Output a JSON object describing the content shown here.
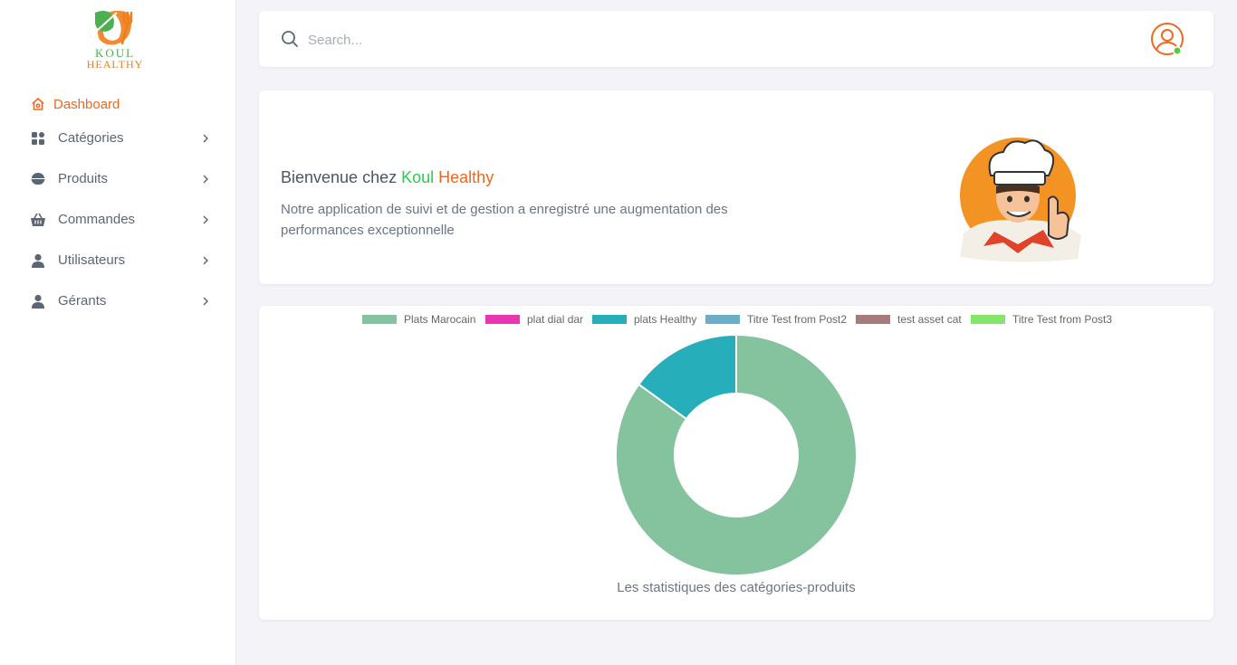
{
  "brand": {
    "line1": "KOUL",
    "line2": "HEALTHY"
  },
  "sidebar": {
    "items": [
      {
        "label": "Dashboard",
        "icon": "home-icon",
        "active": true
      },
      {
        "label": "Catégories",
        "icon": "grid-icon"
      },
      {
        "label": "Produits",
        "icon": "bowl-icon"
      },
      {
        "label": "Commandes",
        "icon": "basket-icon"
      },
      {
        "label": "Utilisateurs",
        "icon": "user-icon"
      },
      {
        "label": "Gérants",
        "icon": "user-icon"
      }
    ]
  },
  "search": {
    "placeholder": "Search..."
  },
  "welcome": {
    "prefix": "Bienvenue chez",
    "brand_koul": "Koul",
    "brand_healthy": "Healthy",
    "text": "Notre application de suivi et de gestion a enregistré une augmentation des performances exceptionnelle"
  },
  "colors": {
    "accent": "#f0671f",
    "brand_green": "#22d14a",
    "status_online": "#4cd137"
  },
  "chart_data": {
    "type": "pie",
    "donut": true,
    "title": "Les statistiques des catégories-produits",
    "legend_position": "top",
    "categories": [
      "Plats Marocain",
      "plat dial dar",
      "plats Healthy",
      "Titre Test from Post2",
      "test asset cat",
      "Titre Test from Post3"
    ],
    "values": [
      85,
      0,
      15,
      0,
      0,
      0
    ],
    "colors": [
      "#85c39e",
      "#e935b1",
      "#26aebb",
      "#6aaec8",
      "#a77b7b",
      "#85e56a"
    ]
  }
}
